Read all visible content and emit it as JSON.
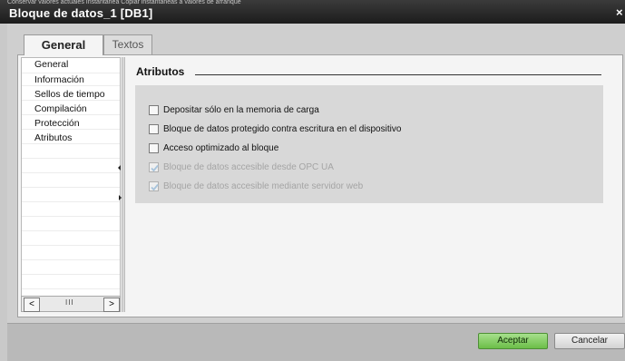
{
  "window": {
    "title": "Bloque de datos_1 [DB1]",
    "background_strip_text": "Conservar valores actuales    Instantánea    Copiar instantáneas a valores de arranque",
    "close_glyph": "×"
  },
  "tabs": [
    {
      "label": "General",
      "active": true
    },
    {
      "label": "Textos",
      "active": false
    }
  ],
  "nav": {
    "items": [
      {
        "label": "General",
        "selected": false
      },
      {
        "label": "Información",
        "selected": false
      },
      {
        "label": "Sellos de tiempo",
        "selected": false
      },
      {
        "label": "Compilación",
        "selected": false
      },
      {
        "label": "Protección",
        "selected": false
      },
      {
        "label": "Atributos",
        "selected": true
      }
    ],
    "scroll_left": "<",
    "scroll_thumb": "III",
    "scroll_right": ">"
  },
  "section": {
    "title": "Atributos",
    "options": [
      {
        "label": "Depositar sólo en la memoria de carga",
        "checked": false,
        "enabled": true
      },
      {
        "label": "Bloque de datos protegido contra escritura en el dispositivo",
        "checked": false,
        "enabled": true
      },
      {
        "label": "Acceso optimizado al bloque",
        "checked": false,
        "enabled": true
      },
      {
        "label": "Bloque de datos accesible desde OPC UA",
        "checked": true,
        "enabled": false
      },
      {
        "label": "Bloque de datos accesible mediante servidor web",
        "checked": true,
        "enabled": false
      }
    ]
  },
  "footer": {
    "ok_label": "Aceptar",
    "cancel_label": "Cancelar"
  },
  "colors": {
    "titlebar": "#1c1c1c",
    "accent_ok": "#6cbe48",
    "disabled_check": "#a8c4dc"
  }
}
